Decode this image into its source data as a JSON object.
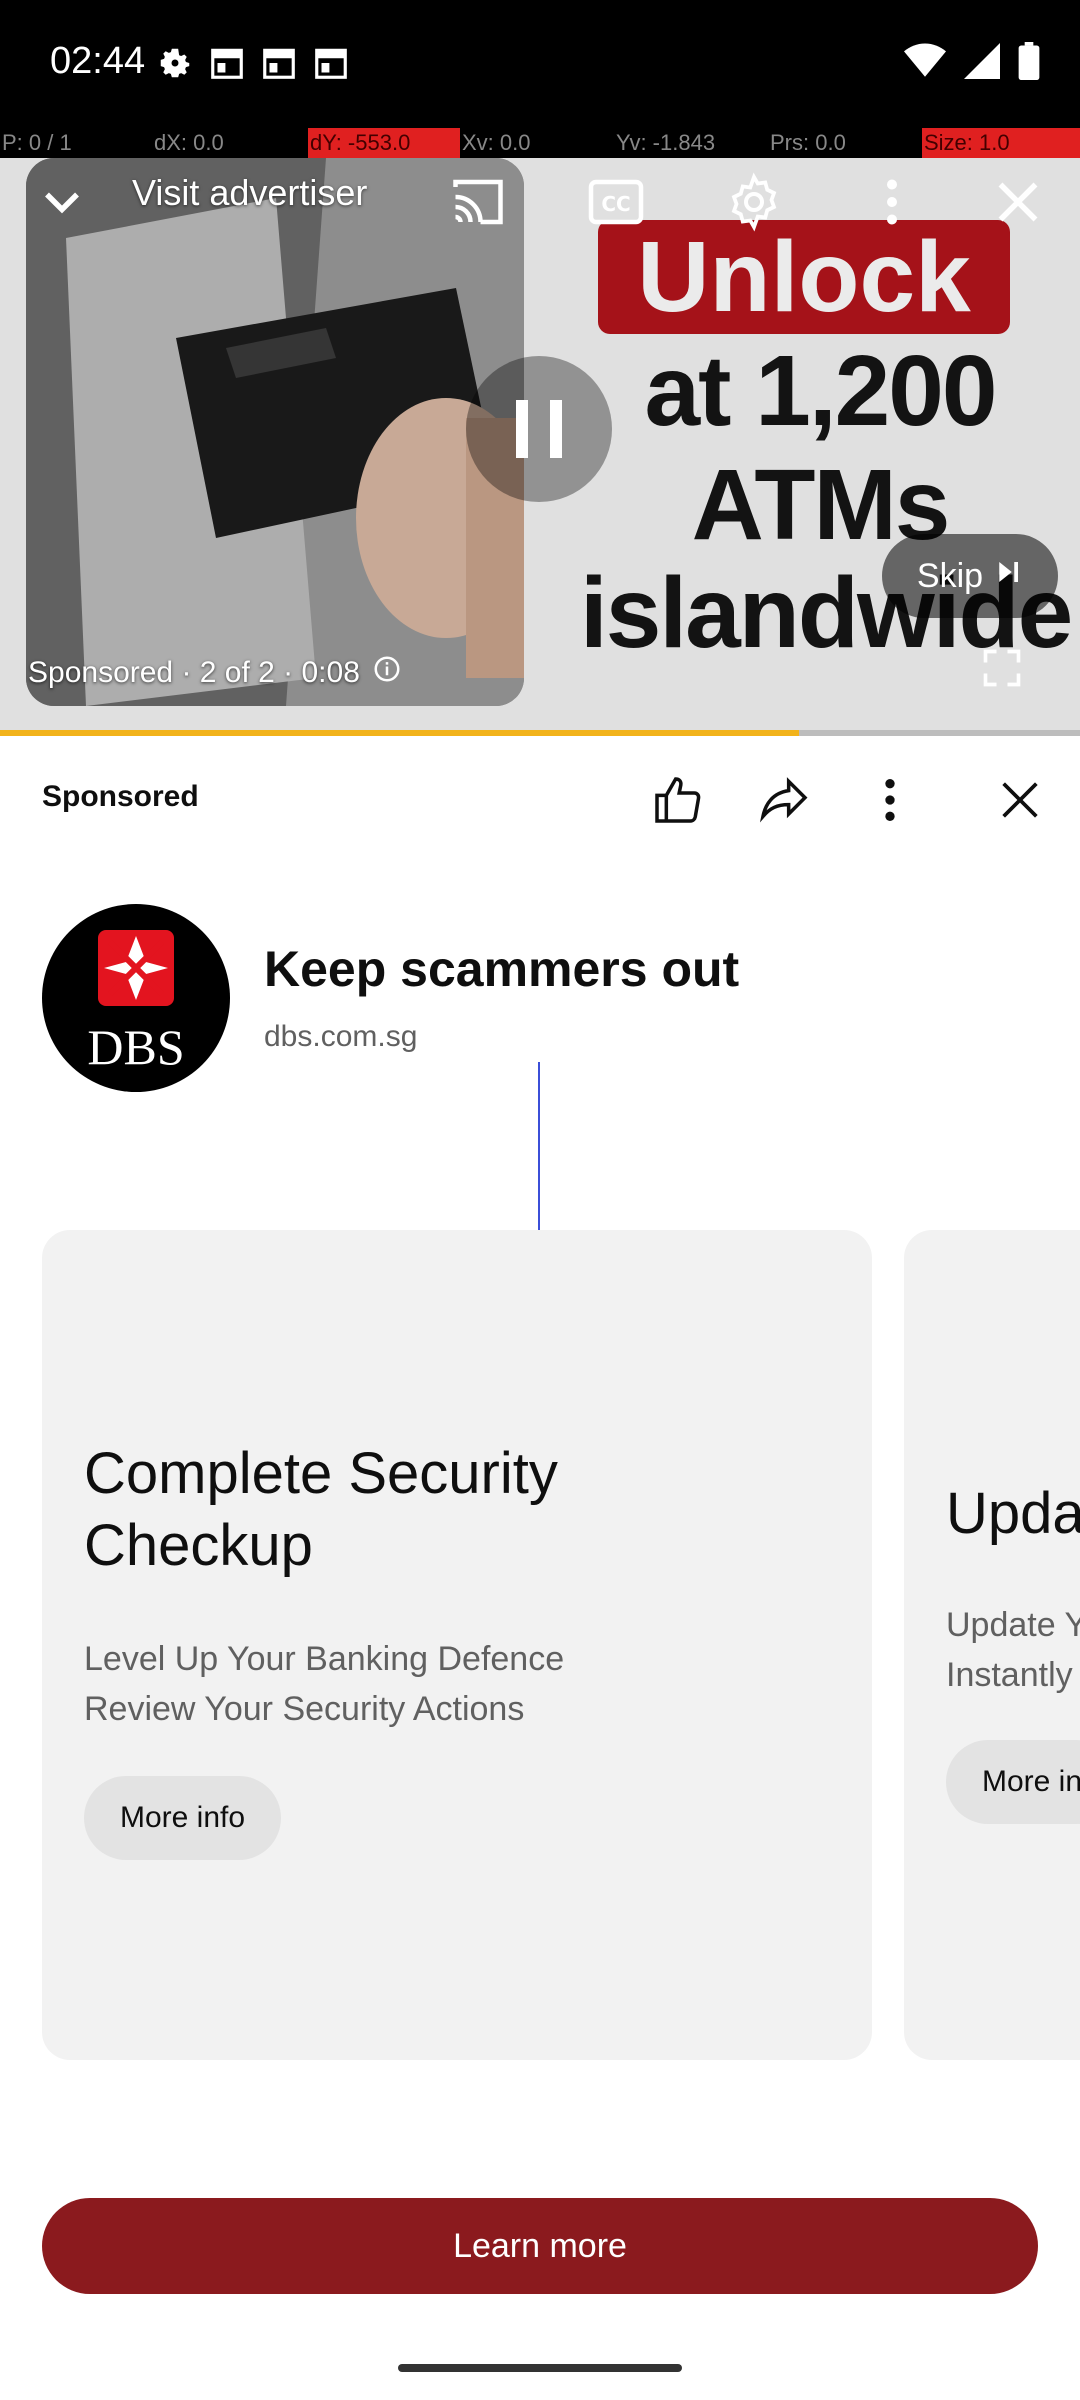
{
  "status_bar": {
    "time": "02:44",
    "left_icons": [
      "settings-icon",
      "calendar-icon",
      "calendar-icon",
      "calendar-icon"
    ],
    "right_icons": [
      "wifi-icon",
      "signal-icon",
      "battery-icon"
    ]
  },
  "debug_bar": {
    "items": [
      "P: 0 / 1",
      "dX: 0.0",
      "dY: -553.0",
      "Xv: 0.0",
      "Yv: -1.843",
      "Prs: 0.0",
      "Size: 1.0"
    ]
  },
  "player": {
    "top_title": "Visit advertiser",
    "ad_headline_lines": [
      "Unlock",
      "at 1,200",
      "ATMs",
      "islandwide"
    ],
    "skip_label": "Skip",
    "sponsor_info": "Sponsored · 2 of 2 · 0:08",
    "progress_percent": 74
  },
  "panel": {
    "label": "Sponsored"
  },
  "advertiser": {
    "title": "Keep scammers out",
    "domain": "dbs.com.sg",
    "logo_text": "DBS"
  },
  "cards": [
    {
      "title_line1": "Complete Security",
      "title_line2": "Checkup",
      "desc_line1": "Level Up Your Banking Defence",
      "desc_line2": "Review Your Security Actions",
      "button": "More info"
    },
    {
      "title": "Upda",
      "desc_line1": "Update Y",
      "desc_line2": "Instantly",
      "button": "More in"
    }
  ],
  "learn_more": "Learn more",
  "colors": {
    "brand_red": "#b3141c",
    "cta": "#8b1a1e",
    "progress": "#f2b31b"
  }
}
